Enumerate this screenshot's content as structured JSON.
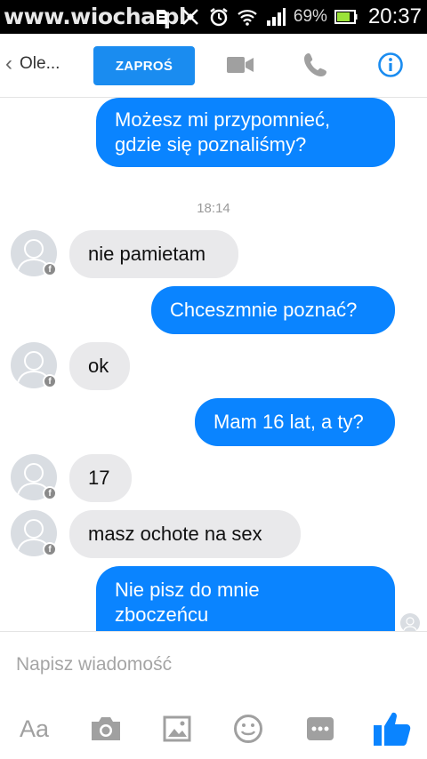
{
  "status_bar": {
    "watermark": "www.wiocha.pl",
    "battery_percent": "69%",
    "time": "20:37",
    "icons": [
      "notification-icon",
      "no-sound-icon",
      "alarm-icon",
      "wifi-icon",
      "signal-icon",
      "battery-icon"
    ]
  },
  "header": {
    "back_label": "Ole...",
    "invite_label": "ZAPROŚ",
    "icons": [
      "video-call-icon",
      "phone-call-icon",
      "info-icon"
    ],
    "accent_color": "#1a8cf0"
  },
  "messages": [
    {
      "direction": "out",
      "text": "Możesz mi przypomnieć,\ngdzie się poznaliśmy?"
    },
    {
      "type": "timestamp",
      "text": "18:14"
    },
    {
      "direction": "in",
      "text": "nie pamietam"
    },
    {
      "direction": "out",
      "text": "Chceszmnie poznać?"
    },
    {
      "direction": "in",
      "text": "ok"
    },
    {
      "direction": "out",
      "text": "Mam 16 lat, a ty?"
    },
    {
      "direction": "in",
      "text": "17"
    },
    {
      "direction": "in",
      "text": "masz ochote na sex"
    },
    {
      "direction": "out",
      "text": "Nie pisz do mnie\nzboczeńcu"
    }
  ],
  "compose": {
    "placeholder": "Napisz wiadomość",
    "aa_label": "Aa",
    "icons": [
      "camera-icon",
      "gallery-icon",
      "emoji-icon",
      "more-icon",
      "like-icon"
    ]
  },
  "colors": {
    "outgoing_bubble": "#0a84ff",
    "incoming_bubble": "#e9e9eb",
    "like_icon": "#0a84ff",
    "toolbar_icon": "#a0a0a0"
  }
}
